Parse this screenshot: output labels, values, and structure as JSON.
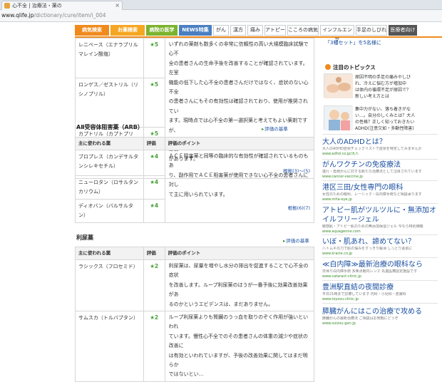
{
  "browser": {
    "tab_title": "心不全 | 治療法・薬の",
    "url_host": "www.qlife.jp",
    "url_path": "/dictionary/cure/item/i_004"
  },
  "nav": {
    "buttons": [
      {
        "label": "病気検索",
        "color": "#f08a1c"
      },
      {
        "label": "お薬検索",
        "color": "#f5a623"
      },
      {
        "label": "病院の医学",
        "color": "#7bb32e"
      },
      {
        "label": "NEWS特集",
        "color": "#4a7fc1"
      }
    ],
    "tags": [
      "がん",
      "漢方",
      "痛み",
      "アトピー",
      "こころの病気",
      "インフルエンザ",
      "手足のしびれ",
      "医療者向け"
    ]
  },
  "table1": {
    "rows": [
      {
        "drug": "レニベース（エナラプリルマレイン酸塩）",
        "rating": "★5"
      },
      {
        "drug": "ロンゲス／ゼストリル（リシノプリル）",
        "rating": "★5"
      },
      {
        "drug": "カプトリル（カプトプリル）",
        "rating": "★5"
      }
    ],
    "point_lines": [
      "いずれの薬剤も数多くの非常に信頼性の高い大規模臨床試験で心不",
      "全の患者さんの生命予後を改善することが確認されています。左室",
      "機能の低下した心不全の患者さんだけではなく、症状のない心不全",
      "の患者さんにもその有効性は確認されており、使用が推奨されてい",
      "ます。現時点では心不全の第一選択薬と考えてもよい薬剤ですが、",
      "電解質異常（カリウムの上昇）や腎機能低下などには留意する必要",
      "があります。"
    ],
    "link": "根拠(3)〜(5)"
  },
  "section2": {
    "title": "AⅡ受容体阻害薬（ARB）",
    "criteria": "評価の基準",
    "headers": [
      "主に使われる薬",
      "評価",
      "評価のポイント"
    ],
    "rows": [
      {
        "drug": "ブロプレス（カンデサルタンシレキセチル）",
        "rating": "★4"
      },
      {
        "drug": "ニューロタン（ロサルタンカリウム）",
        "rating": "★4"
      },
      {
        "drug": "ディオバン（バルサルタン）",
        "rating": "★4"
      }
    ],
    "point_lines": [
      "ＡＣＥ阻害薬と同等の臨床的な有効性が確認されているものもあ",
      "り、副作用でＡＣＥ阻害薬が使用できない心不全の患者さんに対し",
      "て主に用いられています。"
    ],
    "link": "根拠(6)(7)"
  },
  "section3": {
    "title": "利尿薬",
    "criteria": "評価の基準",
    "headers": [
      "主に使われる薬",
      "評価",
      "評価のポイント"
    ],
    "rows": [
      {
        "drug": "ラシックス（フロセミド）",
        "rating": "★2"
      },
      {
        "drug": "サムスカ（トルバプタン）",
        "rating": "★2"
      }
    ],
    "point1_lines": [
      "利尿薬は、尿量を増やし水分の排出を促進することで心不全の症状",
      "を改善します。ループ利尿薬のほうが一番予後に効果改善効果があ",
      "るのかというエビデンスは、まだありません。"
    ],
    "point2_lines": [
      "ループ利尿薬よりも腎臓のうっ血を取りのぞく作用が強いといわれ",
      "ています。慢性心不全でのその患者さんの体重の減少や症状の改善に",
      "は有効といわれていますが、予後の改善効果に関してはまだ明らか",
      "ではないとい..."
    ]
  },
  "sidebar": {
    "top_link": "「3種セット」を5名様に",
    "topics_title": "注目のトピックス",
    "topics": [
      {
        "text_lines": [
          "原因不明の手足の痛みやしび",
          "れ、冷えに悩む方が増加中",
          "は体内の循環不足が原因で？",
          "新しい考え方とは"
        ]
      },
      {
        "text_lines": [
          "集中力がない、落ち着きがな",
          "い…。自分のしくみとは？大人",
          "の性格？正しく知っておきたい",
          "ADHD(注意欠如・多動性障害)"
        ]
      }
    ],
    "ads": [
      {
        "title": "大人のADHDとは？",
        "sub": "大人のADHD症状チェックリストで症状を特定してみませんか",
        "url": "www.adhd.co.jp/大人"
      },
      {
        "title": "がんワクチンの免疫療法",
        "sub": "進行・再発がんに対する新たな治療法として注目されています",
        "url": "www.cancer-vaccine.jp"
      },
      {
        "title": "港区三田/女性専門の眼科",
        "sub": "女性のための眼科、レーシック・白内障手術など相談承ります",
        "url": "www.mita-eye.jp"
      },
      {
        "title": "アトピー肌がツルツルに・無添加オイルフリージェル",
        "sub": "敏感肌・アトピー肌のための無添加保湿ジェル 今なら特別価格",
        "url": "www.aquagenne.com"
      },
      {
        "title": "いぼ・肌あれ、諦めてない？",
        "sub": "ハトムギの力で肌の悩みをすっきり解消 しっとり素肌に",
        "url": "www.kracie.co.jp"
      },
      {
        "title": "≪白内障≫最新治療の眼科なら",
        "sub": "日帰り白内障手術 多焦点眼内レンズ 先進医療認定施設です",
        "url": "www.cataract-clinic.jp"
      },
      {
        "title": "豊洲駅直結の夜間診療",
        "sub": "平日21時まで診療しています 内科・小児科・皮膚科",
        "url": "www.toyosu-clinic.jp"
      },
      {
        "title": "膵臓がんにはこの治療で攻める",
        "sub": "膵臓がんの最新治療法 ご相談はお気軽にどうぞ",
        "url": "www.suizou-gan.jp"
      }
    ]
  }
}
